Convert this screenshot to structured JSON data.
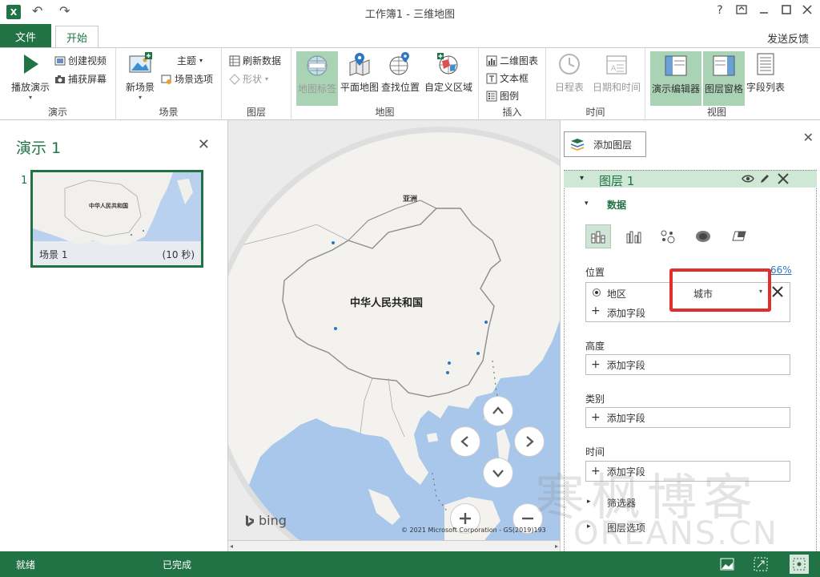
{
  "window": {
    "title": "工作簿1 - 三维地图",
    "help": "?",
    "controls": [
      "restore",
      "minimize",
      "maximize",
      "close"
    ]
  },
  "tabs": {
    "file": "文件",
    "home": "开始",
    "feedback": "发送反馈"
  },
  "ribbon": {
    "tour": {
      "label": "演示",
      "play": "播放演示",
      "create_video": "创建视频",
      "capture_screen": "捕获屏幕"
    },
    "scene": {
      "label": "场景",
      "new_scene": "新场景",
      "theme": "主题",
      "scene_options": "场景选项"
    },
    "layer": {
      "label": "图层",
      "refresh_data": "刷新数据",
      "shapes": "形状"
    },
    "map": {
      "label": "地图",
      "map_labels": "地图标签",
      "flat_map": "平面地图",
      "find_location": "查找位置",
      "custom_regions": "自定义区域"
    },
    "insert": {
      "label": "插入",
      "chart_2d": "二维图表",
      "text_box": "文本框",
      "legend": "图例"
    },
    "time": {
      "label": "时间",
      "timeline": "日程表",
      "date_time": "日期和时间"
    },
    "view": {
      "label": "视图",
      "tour_editor": "演示编辑器",
      "layer_pane": "图层窗格",
      "field_list": "字段列表"
    }
  },
  "tour_panel": {
    "title": "演示 1",
    "scene_number": "1",
    "scene_name": "场景 1",
    "scene_duration": "(10 秒)",
    "thumb_country": "中华人民共和国"
  },
  "map": {
    "continent_label": "亚洲",
    "country_label": "中华人民共和国",
    "bing": "bing",
    "copyright": "© 2021 Microsoft Corporation - GS(2019)193"
  },
  "layer_panel": {
    "add_layer": "添加图层",
    "layer_name": "图层 1",
    "data_section": "数据",
    "location_label": "位置",
    "location_confidence": "66%",
    "location_field": "地区",
    "location_type": "城市",
    "add_field": "添加字段",
    "height_label": "高度",
    "category_label": "类别",
    "time_label": "时间",
    "filters": "筛选器",
    "layer_options": "图层选项"
  },
  "status": {
    "ready": "就绪",
    "completed": "已完成"
  },
  "watermark": {
    "text": "寒枫博客",
    "url": "OREANS.CN"
  },
  "colors": {
    "accent": "#217346",
    "highlight": "#a9d3b4",
    "ocean": "#a8c7ea",
    "land": "#f4f2ee",
    "annotation": "#e0302e"
  }
}
